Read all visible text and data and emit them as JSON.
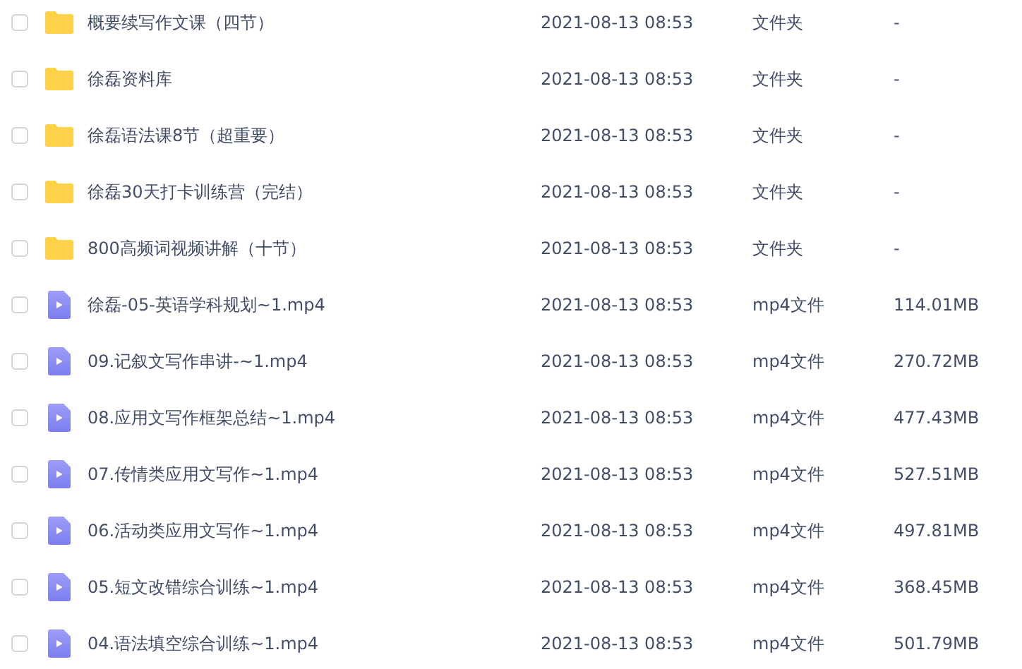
{
  "files": [
    {
      "kind": "folder",
      "checked": false,
      "name": "概要续写作文课（四节）",
      "modified": "2021-08-13 08:53",
      "type": "文件夹",
      "size": "-"
    },
    {
      "kind": "folder",
      "checked": false,
      "name": "徐磊资料库",
      "modified": "2021-08-13 08:53",
      "type": "文件夹",
      "size": "-"
    },
    {
      "kind": "folder",
      "checked": false,
      "name": "徐磊语法课8节（超重要）",
      "modified": "2021-08-13 08:53",
      "type": "文件夹",
      "size": "-"
    },
    {
      "kind": "folder",
      "checked": false,
      "name": "徐磊30天打卡训练营（完结）",
      "modified": "2021-08-13 08:53",
      "type": "文件夹",
      "size": "-"
    },
    {
      "kind": "folder",
      "checked": false,
      "name": "800高频词视频讲解（十节）",
      "modified": "2021-08-13 08:53",
      "type": "文件夹",
      "size": "-"
    },
    {
      "kind": "video",
      "checked": false,
      "name": "徐磊-05-英语学科规划~1.mp4",
      "modified": "2021-08-13 08:53",
      "type": "mp4文件",
      "size": "114.01MB"
    },
    {
      "kind": "video",
      "checked": false,
      "name": "09.记叙文写作串讲-~1.mp4",
      "modified": "2021-08-13 08:53",
      "type": "mp4文件",
      "size": "270.72MB"
    },
    {
      "kind": "video",
      "checked": false,
      "name": "08.应用文写作框架总结~1.mp4",
      "modified": "2021-08-13 08:53",
      "type": "mp4文件",
      "size": "477.43MB"
    },
    {
      "kind": "video",
      "checked": false,
      "name": "07.传情类应用文写作~1.mp4",
      "modified": "2021-08-13 08:53",
      "type": "mp4文件",
      "size": "527.51MB"
    },
    {
      "kind": "video",
      "checked": false,
      "name": "06.活动类应用文写作~1.mp4",
      "modified": "2021-08-13 08:53",
      "type": "mp4文件",
      "size": "497.81MB"
    },
    {
      "kind": "video",
      "checked": false,
      "name": "05.短文改错综合训练~1.mp4",
      "modified": "2021-08-13 08:53",
      "type": "mp4文件",
      "size": "368.45MB"
    },
    {
      "kind": "video",
      "checked": false,
      "name": "04.语法填空综合训练~1.mp4",
      "modified": "2021-08-13 08:53",
      "type": "mp4文件",
      "size": "501.79MB"
    }
  ]
}
